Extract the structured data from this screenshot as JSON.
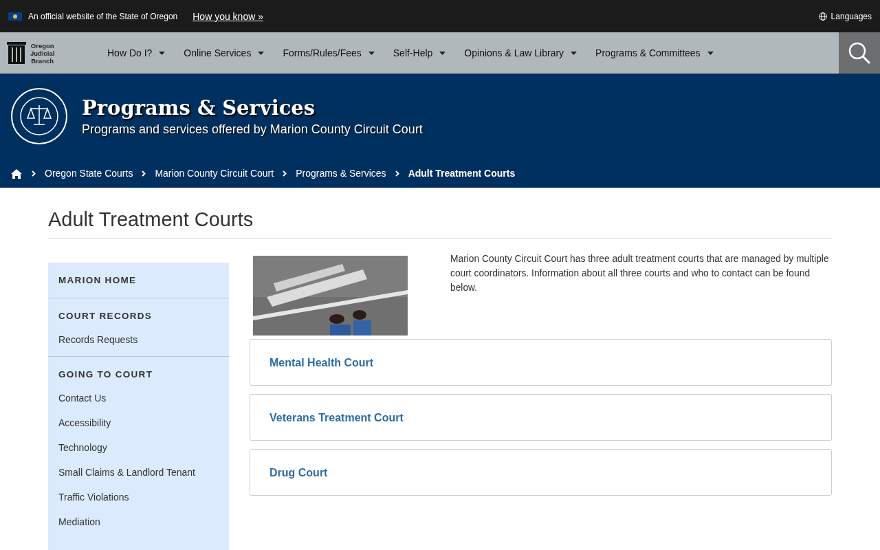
{
  "gov_banner": {
    "text": "An official website of the State of Oregon",
    "link": "How you know »",
    "languages": "Languages"
  },
  "nav": {
    "logo_text": [
      "Oregon",
      "Judicial",
      "Branch"
    ],
    "items": [
      {
        "label": "How Do I?"
      },
      {
        "label": "Online Services"
      },
      {
        "label": "Forms/Rules/Fees"
      },
      {
        "label": "Self-Help"
      },
      {
        "label": "Opinions & Law Library"
      },
      {
        "label": "Programs & Committees"
      }
    ]
  },
  "header": {
    "title": "Programs & Services",
    "subtitle": "Programs and services offered by Marion County Circuit Court"
  },
  "breadcrumbs": [
    {
      "label": "Oregon State Courts",
      "current": false
    },
    {
      "label": "Marion County Circuit Court",
      "current": false
    },
    {
      "label": "Programs & Services",
      "current": false
    },
    {
      "label": "Adult Treatment Courts",
      "current": true
    }
  ],
  "page_title": "Adult Treatment Courts",
  "sidebar": [
    {
      "heading": "MARION HOME"
    },
    {
      "heading": "COURT RECORDS",
      "items": [
        "Records Requests"
      ]
    },
    {
      "heading": "GOING TO COURT",
      "items": [
        "Contact Us",
        "Accessibility",
        "Technology",
        "Small Claims & Landlord Tenant",
        "Traffic Violations",
        "Mediation"
      ]
    }
  ],
  "intro": "Marion County Circuit Court has three adult treatment courts that are managed by multiple court coordinators. Information about all three courts and who to contact can be found below.",
  "panels": [
    "Mental Health Court",
    "Veterans Treatment Court",
    "Drug Court"
  ]
}
